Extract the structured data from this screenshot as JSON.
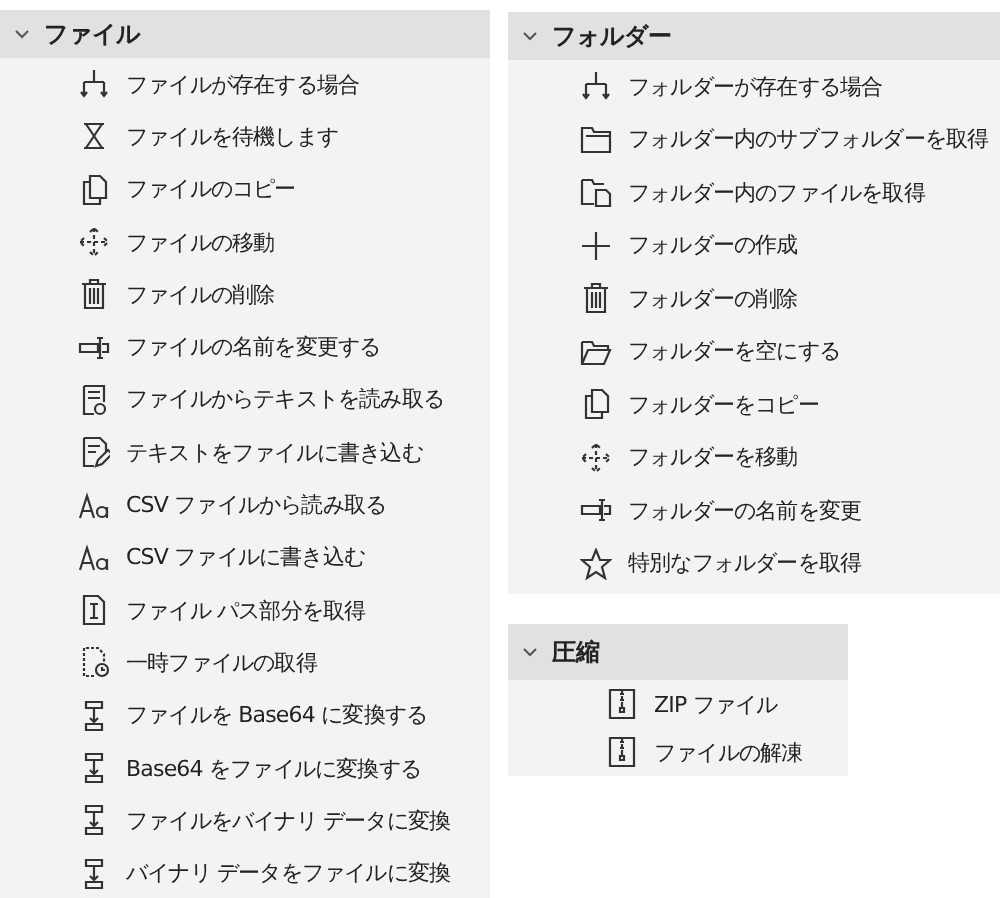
{
  "groups": [
    {
      "title": "ファイル",
      "expanded": true,
      "items": [
        {
          "kind": "branch",
          "label": "ファイルが存在する場合"
        },
        {
          "kind": "hourglass",
          "label": "ファイルを待機します"
        },
        {
          "kind": "copy",
          "label": "ファイルのコピー"
        },
        {
          "kind": "move",
          "label": "ファイルの移動"
        },
        {
          "kind": "trash",
          "label": "ファイルの削除"
        },
        {
          "kind": "rename",
          "label": "ファイルの名前を変更する"
        },
        {
          "kind": "read-text",
          "label": "ファイルからテキストを読み取る"
        },
        {
          "kind": "write-text",
          "label": "テキストをファイルに書き込む"
        },
        {
          "kind": "text",
          "label": "CSV ファイルから読み取る"
        },
        {
          "kind": "text",
          "label": "CSV ファイルに書き込む"
        },
        {
          "kind": "path",
          "label": "ファイル パス部分を取得"
        },
        {
          "kind": "temp",
          "label": "一時ファイルの取得"
        },
        {
          "kind": "convert",
          "label": "ファイルを Base64 に変換する"
        },
        {
          "kind": "convert",
          "label": "Base64 をファイルに変換する"
        },
        {
          "kind": "convert",
          "label": "ファイルをバイナリ データに変換"
        },
        {
          "kind": "convert",
          "label": "バイナリ データをファイルに変換"
        }
      ]
    },
    {
      "title": "フォルダー",
      "expanded": true,
      "items": [
        {
          "kind": "branch",
          "label": "フォルダーが存在する場合"
        },
        {
          "kind": "subfolders",
          "label": "フォルダー内のサブフォルダーを取得"
        },
        {
          "kind": "folder-files",
          "label": "フォルダー内のファイルを取得"
        },
        {
          "kind": "plus",
          "label": "フォルダーの作成"
        },
        {
          "kind": "trash",
          "label": "フォルダーの削除"
        },
        {
          "kind": "folder",
          "label": "フォルダーを空にする"
        },
        {
          "kind": "copy",
          "label": "フォルダーをコピー"
        },
        {
          "kind": "move",
          "label": "フォルダーを移動"
        },
        {
          "kind": "rename",
          "label": "フォルダーの名前を変更"
        },
        {
          "kind": "star",
          "label": "特別なフォルダーを取得"
        }
      ]
    },
    {
      "title": "圧縮",
      "expanded": true,
      "items": [
        {
          "kind": "zip",
          "label": "ZIP ファイル"
        },
        {
          "kind": "zip",
          "label": "ファイルの解凍"
        }
      ]
    }
  ]
}
